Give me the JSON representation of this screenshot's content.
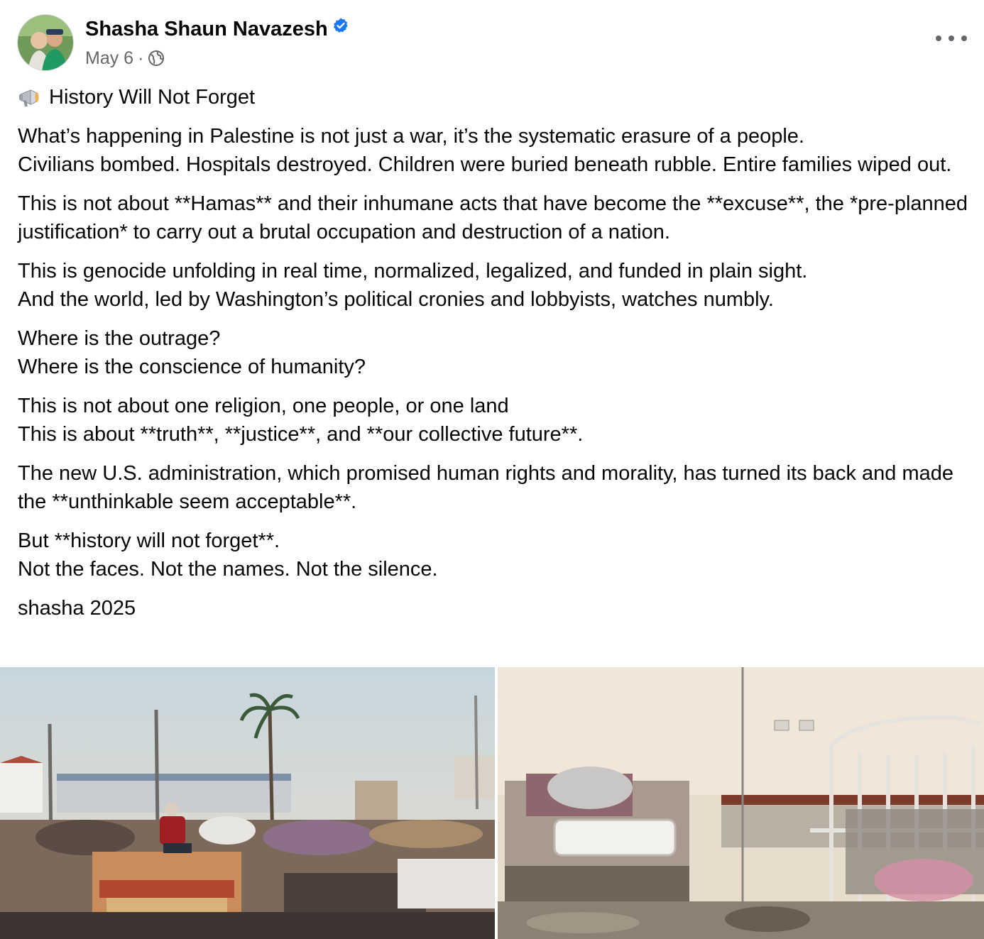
{
  "post": {
    "author": "Shasha Shaun Navazesh",
    "date": "May 6",
    "separator": "·",
    "title_emoji": "megaphone",
    "title": "History Will Not Forget",
    "paragraphs": [
      [
        "What’s happening in Palestine is not just a war, it’s the systematic erasure of a people.",
        "Civilians bombed. Hospitals destroyed. Children were buried beneath rubble. Entire families wiped out."
      ],
      [
        "This is not about **Hamas** and their inhumane acts that have become the **excuse**, the *pre-planned justification* to carry out a brutal occupation and destruction of a nation."
      ],
      [
        "This is genocide unfolding in real time, normalized, legalized, and funded in plain sight.",
        "And the world, led by Washington’s political cronies and lobbyists, watches numbly."
      ],
      [
        "Where is the outrage?",
        "Where is the conscience of humanity?"
      ],
      [
        "This is not about one religion, one people, or one land",
        "This is about **truth**, **justice**, and **our collective future**."
      ],
      [
        "The new U.S. administration, which promised human rights and morality, has turned its back and made the **unthinkable seem acceptable**."
      ],
      [
        "But **history will not forget**.",
        "Not the faces. Not the names. Not the silence."
      ],
      [
        "shasha 2025"
      ]
    ]
  },
  "icons": {
    "verified": "verified-badge-icon",
    "audience": "globe-icon",
    "more": "more-options-icon",
    "title": "megaphone-icon"
  },
  "colors": {
    "text": "#050505",
    "secondary": "#65676b",
    "verified": "#1877f2"
  }
}
